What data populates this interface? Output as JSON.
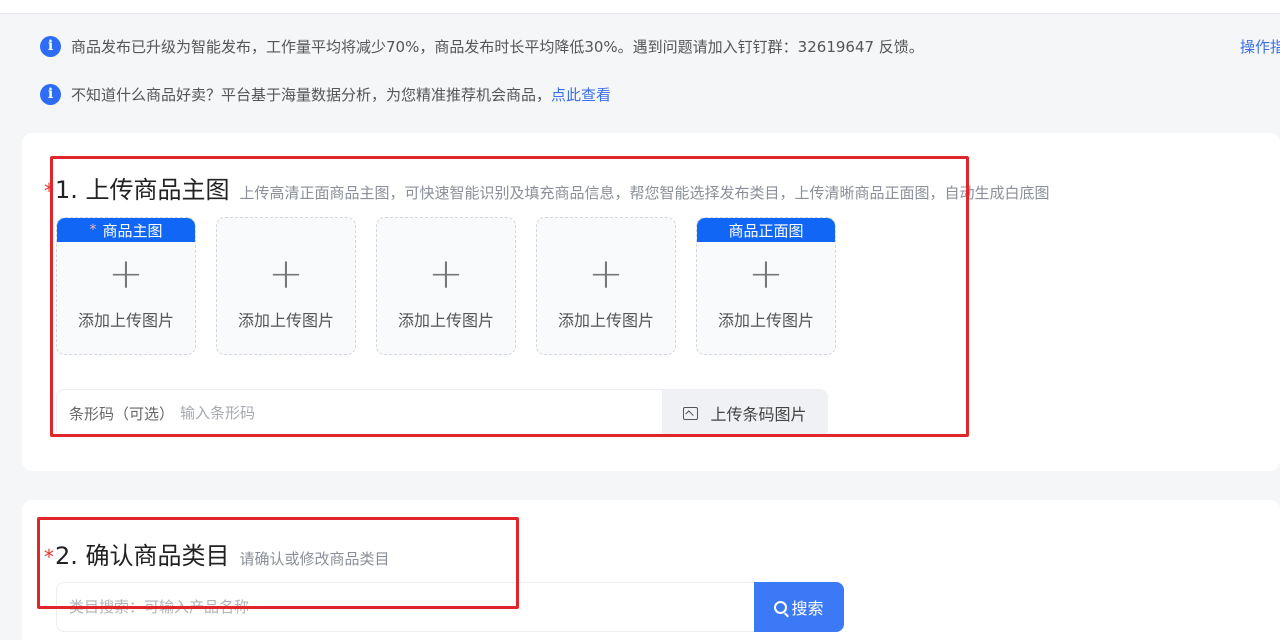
{
  "notices": [
    {
      "icon": "info-icon",
      "text": "商品发布已升级为智能发布，工作量平均将减少70%，商品发布时长平均降低30%。遇到问题请加入钉钉群：32619647 反馈。"
    },
    {
      "icon": "info-icon",
      "text": "不知道什么商品好卖？平台基于海量数据分析，为您精准推荐机会商品，",
      "link": "点此查看"
    }
  ],
  "corner_link": "操作指",
  "upload_section": {
    "required_mark": "*",
    "title": "1. 上传商品主图",
    "hint": "上传高清正面商品主图，可快速智能识别及填充商品信息，帮您智能选择发布类目，上传清晰商品正面图，自动生成白底图",
    "slots": [
      {
        "tag": "商品主图",
        "tag_required": "*",
        "label": "添加上传图片",
        "icon": "plus-icon"
      },
      {
        "tag": "",
        "label": "添加上传图片",
        "icon": "plus-icon"
      },
      {
        "tag": "",
        "label": "添加上传图片",
        "icon": "plus-icon"
      },
      {
        "tag": "",
        "label": "添加上传图片",
        "icon": "plus-icon"
      },
      {
        "tag": "商品正面图",
        "label": "添加上传图片",
        "icon": "plus-icon"
      }
    ],
    "barcode": {
      "label": "条形码（可选）",
      "placeholder": "输入条形码",
      "upload_label": "上传条码图片",
      "upload_icon": "image-icon"
    }
  },
  "category_section": {
    "required_mark": "*",
    "title": "2. 确认商品类目",
    "hint": "请确认或修改商品类目",
    "search_placeholder": "类目搜索：可输入产品名称",
    "search_button": "搜索",
    "search_icon": "search-icon"
  },
  "colors": {
    "accent": "#1266f5",
    "search_button": "#3c79f7",
    "link": "#3b6fe8",
    "annotation_box": "#e0262b",
    "required": "#e53935"
  }
}
